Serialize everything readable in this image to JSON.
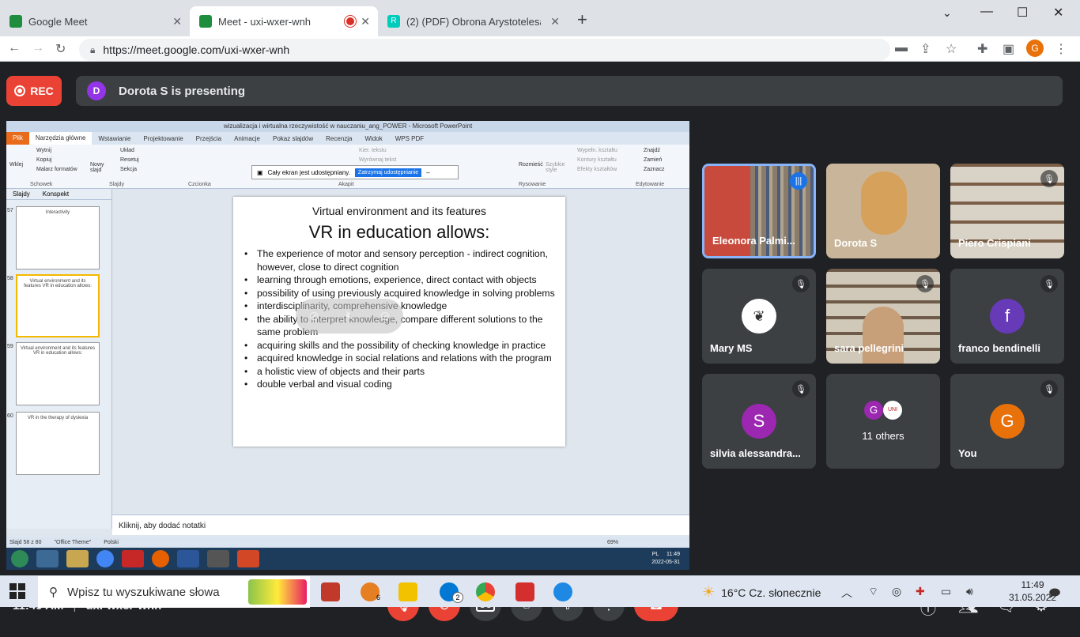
{
  "browser": {
    "tabs": [
      {
        "title": "Google Meet",
        "color": "#1e8e3e"
      },
      {
        "title": "Meet - uxi-wxer-wnh",
        "color": "#1e8e3e",
        "recording": true
      },
      {
        "title": "(2) (PDF) Obrona Arystotelesa: re",
        "color": "#00ccbb"
      }
    ],
    "url": "https://meet.google.com/uxi-wxer-wnh",
    "profile_letter": "G"
  },
  "meet": {
    "rec_label": "REC",
    "presenter_initial": "D",
    "presenting_text": "Dorota S is presenting",
    "time": "11:49 AM",
    "meeting_code": "uxi-wxer-wnh",
    "participant_count": "20"
  },
  "ppt": {
    "window_title": "wizualizacja i wirtualna rzeczywistość w nauczaniu_ang_POWER - Microsoft PowerPoint",
    "ribbon_tabs": [
      "Plik",
      "Narzędzia główne",
      "Wstawianie",
      "Projektowanie",
      "Przejścia",
      "Animacje",
      "Pokaz slajdów",
      "Recenzja",
      "Widok",
      "WPS PDF"
    ],
    "ribbon_groups": [
      "Schowek",
      "Slajdy",
      "Czcionka",
      "Akapit",
      "Rysowanie",
      "Edytowanie"
    ],
    "ribbon_items": [
      "Wklej",
      "Wytnij",
      "Kopiuj",
      "Malarz formatów",
      "Nowy slajd",
      "Układ",
      "Resetuj",
      "Sekcja",
      "Kier. tekstu",
      "Wyrównaj tekst",
      "Rozmieść",
      "Szybkie style",
      "Wypełn. kształtu",
      "Kontury kształtu",
      "Efekty kształtów",
      "Znajdź",
      "Zamień",
      "Zaznacz"
    ],
    "share_banner": "Cały ekran jest udostępniany.",
    "stop_share": "Zatrzymaj udostępnianie",
    "pane_tabs": [
      "Slajdy",
      "Konspekt"
    ],
    "thumbs": [
      {
        "num": "57",
        "title": "Interactivity"
      },
      {
        "num": "58",
        "title": "Virtual environment and its features VR in education allows:"
      },
      {
        "num": "59",
        "title": "Virtual environment and its features VR in education allows:"
      },
      {
        "num": "60",
        "title": "VR in the therapy of dyslexia"
      }
    ],
    "slide": {
      "subtitle": "Virtual environment and its features",
      "heading": "VR in education allows:",
      "bullets": [
        "The experience of motor and sensory perception - indirect cognition, however, close to direct cognition",
        "learning through emotions, experience, direct contact with objects",
        "possibility of using previously acquired knowledge in solving problems",
        "interdisciplinarity, comprehensive knowledge",
        "the ability to interpret knowledge, compare different solutions to the same problem",
        "acquiring skills and the possibility of checking knowledge in practice",
        "acquired knowledge in social relations and relations with the program",
        "a holistic view of objects and their parts",
        "double verbal and visual coding"
      ]
    },
    "notes_placeholder": "Kliknij, aby dodać notatki",
    "status": {
      "slide": "Slajd 58 z 80",
      "theme": "\"Office Theme\"",
      "lang": "Polski",
      "zoom": "69%"
    },
    "win7_clock": {
      "lang": "PL",
      "time": "11:49",
      "date": "2022-05-31"
    }
  },
  "participants": [
    {
      "name": "Eleonora Palmi...",
      "type": "video",
      "speaking": true
    },
    {
      "name": "Dorota S",
      "type": "video"
    },
    {
      "name": "Piero Crispiani",
      "type": "video",
      "muted": true
    },
    {
      "name": "Mary MS",
      "type": "avatar",
      "muted": true,
      "avatar_color": "#ffffff"
    },
    {
      "name": "sara pellegrini",
      "type": "video",
      "muted": true
    },
    {
      "name": "franco bendinelli",
      "type": "avatar",
      "initial": "f",
      "avatar_color": "#673ab7",
      "muted": true
    },
    {
      "name": "silvia alessandra...",
      "type": "avatar",
      "initial": "S",
      "avatar_color": "#9c27b0",
      "muted": true
    },
    {
      "name": "11 others",
      "type": "others",
      "initial": "G"
    },
    {
      "name": "You",
      "type": "avatar",
      "initial": "G",
      "avatar_color": "#e8710a",
      "muted": true
    }
  ],
  "taskbar": {
    "search_placeholder": "Wpisz tu wyszukiwane słowa",
    "weather": "16°C  Cz. słonecznie",
    "time": "11:49",
    "date": "31.05.2022",
    "badge_6": "6",
    "badge_2": "2"
  }
}
